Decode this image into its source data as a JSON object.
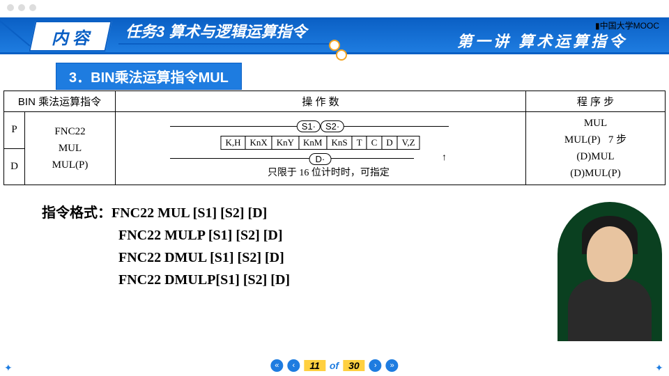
{
  "header": {
    "mooc": "中国大学MOOC",
    "content_tab": "内 容",
    "task_title": "任务3  算术与逻辑运算指令",
    "lecture_title": "第一讲  算术运算指令",
    "section": "3．BIN乘法运算指令MUL"
  },
  "table": {
    "col1_header": "BIN 乘法运算指令",
    "col2_header": "操  作  数",
    "col3_header": "程 序 步",
    "left_p": "P",
    "left_d": "D",
    "fnc": "FNC22\nMUL\nMUL(P)",
    "s1": "S1·",
    "s2": "S2·",
    "dlbl": "D·",
    "boxes": [
      "K,H",
      "KnX",
      "KnY",
      "KnM",
      "KnS",
      "T",
      "C",
      "D",
      "V,Z"
    ],
    "note": "只限于 16 位计时时，可指定",
    "steps": "MUL\nMUL(P)   7 步\n(D)MUL\n(D)MUL(P)"
  },
  "format": {
    "lead": "指令格式：",
    "l1": "FNC22  MUL    [S1] [S2] [D]",
    "l2": "FNC22  MULP [S1] [S2] [D]",
    "l3": "FNC22  DMUL  [S1] [S2] [D]",
    "l4": "FNC22  DMULP[S1] [S2] [D]"
  },
  "pager": {
    "cur": "11",
    "of": "of",
    "total": "30"
  }
}
